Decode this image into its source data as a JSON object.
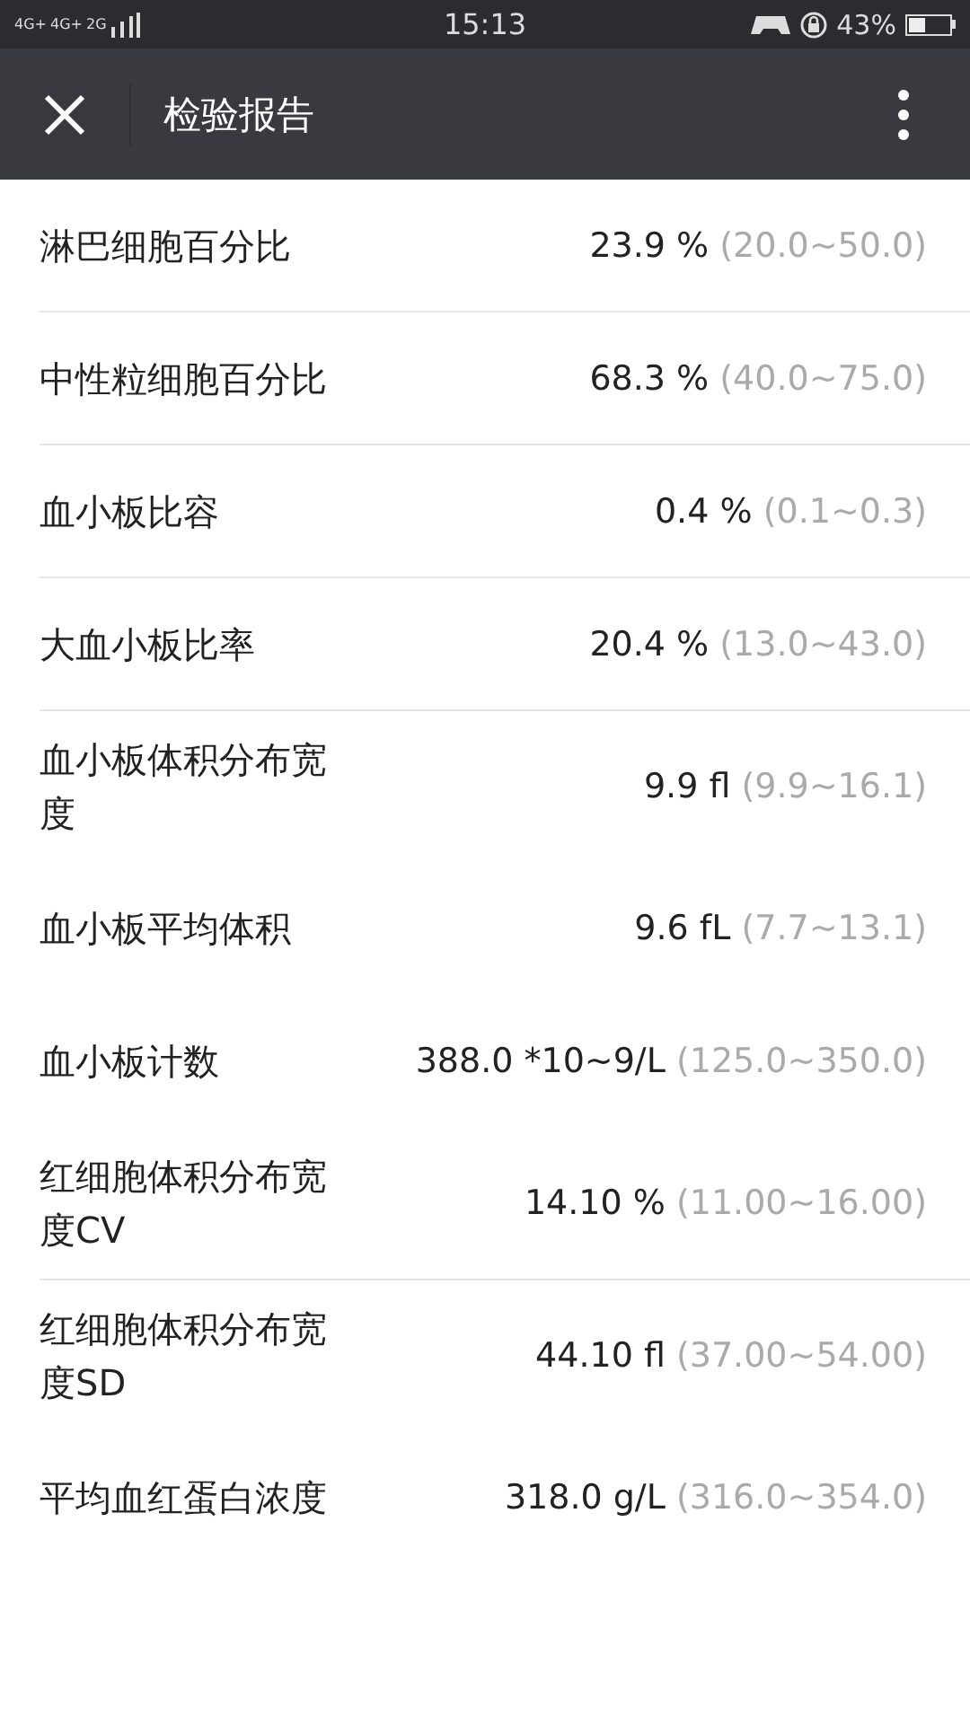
{
  "status_bar": {
    "network_labels": [
      "4G+",
      "4G+",
      "2G"
    ],
    "time": "15:13",
    "battery_text": "43%"
  },
  "header": {
    "title": "检验报告"
  },
  "rows": [
    {
      "name": "淋巴细胞百分比",
      "value": "23.9 %",
      "range": "(20.0~50.0)",
      "divider": true
    },
    {
      "name": "中性粒细胞百分比",
      "value": "68.3 %",
      "range": "(40.0~75.0)",
      "divider": true
    },
    {
      "name": "血小板比容",
      "value": "0.4 %",
      "range": "(0.1~0.3)",
      "divider": true
    },
    {
      "name": "大血小板比率",
      "value": "20.4 %",
      "range": "(13.0~43.0)",
      "divider": true
    },
    {
      "name": "血小板体积分布宽度",
      "value": "9.9 fl",
      "range": "(9.9~16.1)",
      "divider": false
    },
    {
      "name": "血小板平均体积",
      "value": "9.6 fL",
      "range": "(7.7~13.1)",
      "divider": false
    },
    {
      "name": "血小板计数",
      "value": "388.0 *10~9/L",
      "range": "(125.0~350.0)",
      "divider": false
    },
    {
      "name": "红细胞体积分布宽度CV",
      "value": "14.10 %",
      "range": "(11.00~16.00)",
      "divider": true
    },
    {
      "name": "红细胞体积分布宽度SD",
      "value": "44.10 fl",
      "range": "(37.00~54.00)",
      "divider": false
    },
    {
      "name": "平均血红蛋白浓度",
      "value": "318.0 g/L",
      "range": "(316.0~354.0)",
      "divider": false
    }
  ]
}
